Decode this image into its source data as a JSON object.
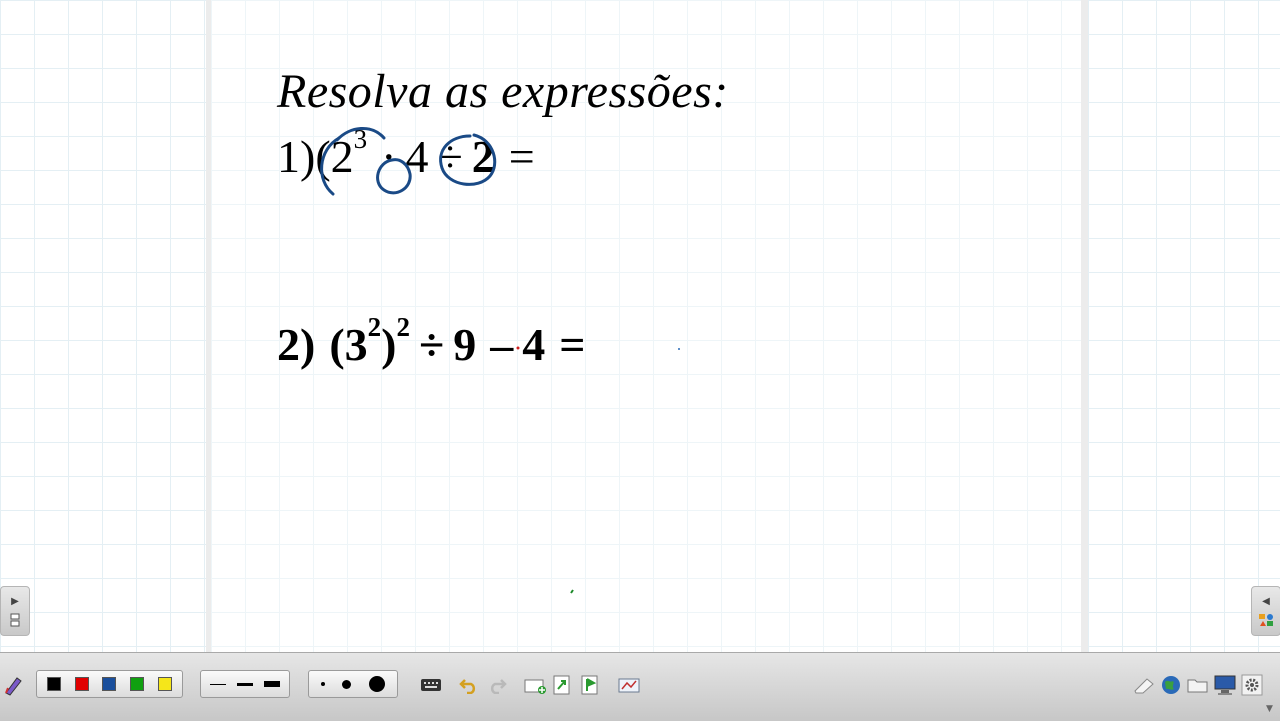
{
  "board": {
    "title": "Resolva as expressões:",
    "expression_1": {
      "label": "1)",
      "open_paren": "(",
      "base": "2",
      "exponent": "3",
      "times": "·",
      "factor": "4",
      "divide": "÷",
      "divisor": "2",
      "equals": "="
    },
    "expression_2": {
      "label": "2)",
      "open_paren": "(",
      "inner_base": "3",
      "inner_exponent": "2",
      "close_paren": ")",
      "outer_exponent": "2",
      "divide": "÷",
      "divisor": "9",
      "minus": "–",
      "subtrahend": "4",
      "equals": "="
    }
  },
  "ink": {
    "annotation_color": "#1a4a86",
    "stray_colors": [
      "#d02020",
      "#2a6ab8",
      "#1e8a2a"
    ]
  },
  "toolbar": {
    "colors": [
      "#000000",
      "#e00000",
      "#1a4f9c",
      "#10a010",
      "#f5e61a"
    ],
    "line_widths": [
      "thin",
      "medium",
      "thick"
    ],
    "point_sizes": [
      "small",
      "medium",
      "large"
    ],
    "icons": {
      "pen": "pen-icon",
      "keyboard": "keyboard-icon",
      "undo": "undo-icon",
      "redo": "redo-icon",
      "new_page": "new-page-icon",
      "next_page": "next-page-icon",
      "page_flag": "page-flag-icon",
      "capture": "capture-icon",
      "eraser": "eraser-icon",
      "globe": "globe-icon",
      "folder": "folder-icon",
      "display": "display-icon",
      "settings": "settings-icon"
    }
  },
  "side_tabs": {
    "left": "expand-right-icon",
    "right": "expand-left-icon"
  }
}
